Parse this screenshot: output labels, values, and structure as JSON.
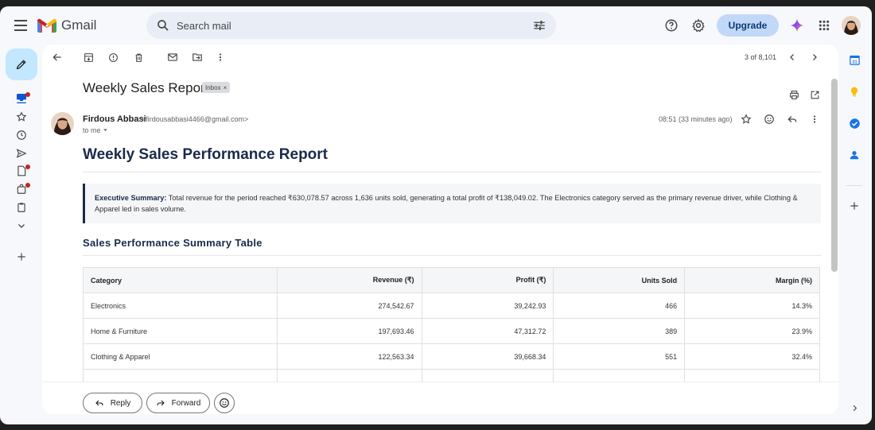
{
  "app": {
    "name": "Gmail"
  },
  "search": {
    "placeholder": "Search mail"
  },
  "header": {
    "upgrade_label": "Upgrade"
  },
  "toolbar": {
    "pager": "3 of 8,101"
  },
  "email": {
    "subject": "Weekly Sales Report",
    "label_chip": "Inbox",
    "label_chip_close": "×",
    "sender_name": "Firdous Abbasi",
    "sender_email": "<firdousabbasi4466@gmail.com>",
    "recipient": "to me",
    "time": "08:51 (33 minutes ago)"
  },
  "report": {
    "title": "Weekly Sales Performance Report",
    "exec_label": "Executive Summary:",
    "exec_text": " Total revenue for the period reached ₹630,078.57 across 1,636 units sold, generating a total profit of ₹138,049.02. The Electronics category served as the primary revenue driver, while Clothing & Apparel led in sales volume.",
    "table_title": "Sales Performance Summary Table",
    "columns": [
      "Category",
      "Revenue (₹)",
      "Profit (₹)",
      "Units Sold",
      "Margin (%)"
    ],
    "rows": [
      [
        "Electronics",
        "274,542.67",
        "39,242.93",
        "466",
        "14.3%"
      ],
      [
        "Home & Furniture",
        "197,693.46",
        "47,312.72",
        "389",
        "23.9%"
      ],
      [
        "Clothing & Apparel",
        "122,563.34",
        "39,668.34",
        "551",
        "32.4%"
      ]
    ]
  },
  "footer": {
    "reply_label": "Reply",
    "forward_label": "Forward"
  },
  "colors": {
    "accent": "#c2e7ff",
    "upgrade": "#c2d8f8",
    "heading": "#1a2a4a",
    "unread_dot": "#c5221f"
  }
}
